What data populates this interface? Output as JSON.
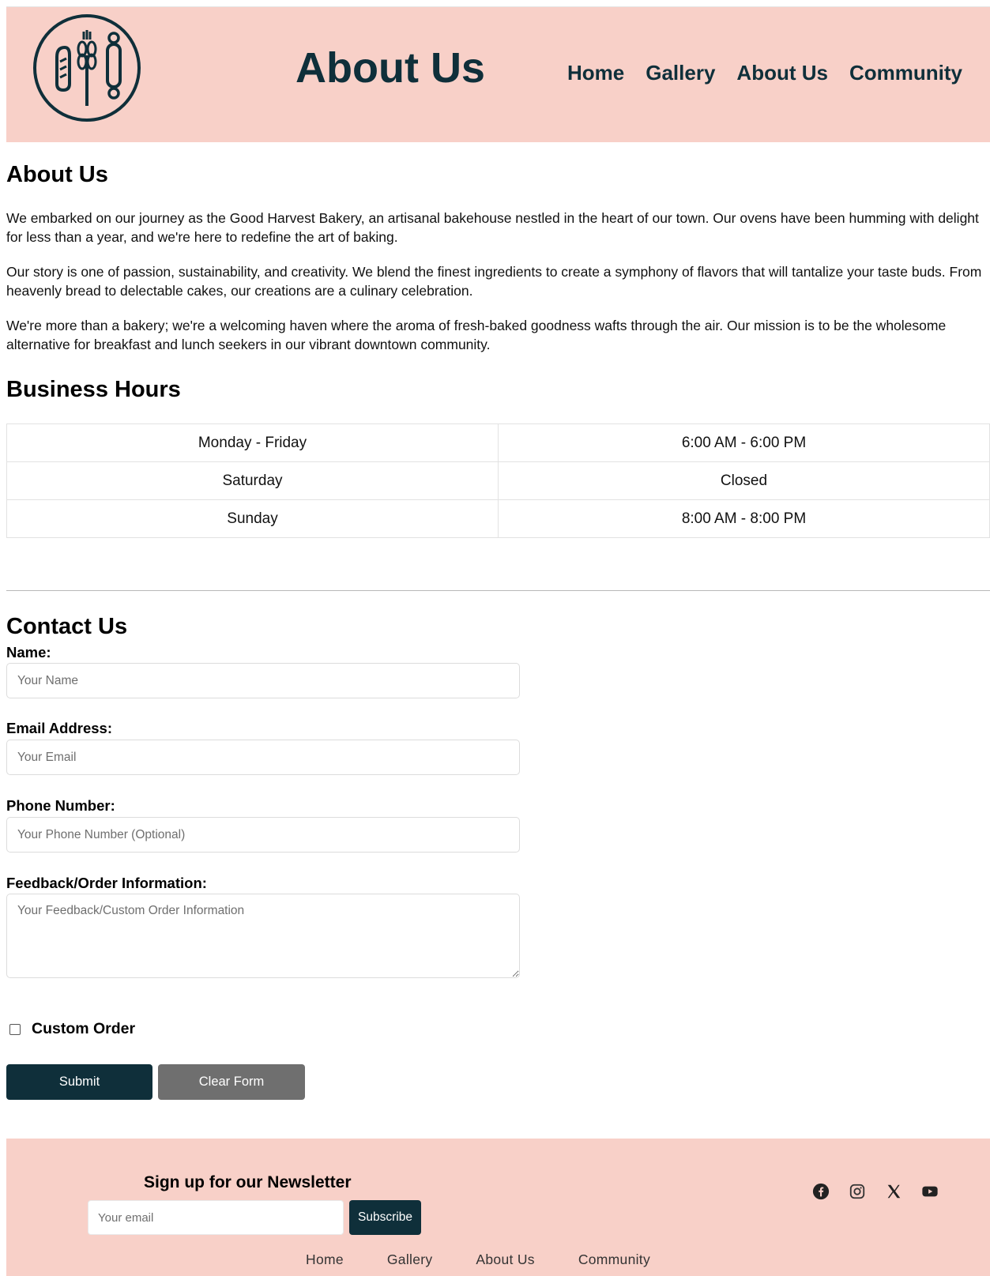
{
  "header": {
    "logo_icon": "bakery-logo-icon",
    "title": "About Us",
    "nav": [
      {
        "label": "Home"
      },
      {
        "label": "Gallery"
      },
      {
        "label": "About Us"
      },
      {
        "label": "Community"
      }
    ]
  },
  "about": {
    "heading": "About Us",
    "paragraphs": [
      "We embarked on our journey as the Good Harvest Bakery, an artisanal bakehouse nestled in the heart of our town. Our ovens have been humming with delight for less than a year, and we're here to redefine the art of baking.",
      "Our story is one of passion, sustainability, and creativity. We blend the finest ingredients to create a symphony of flavors that will tantalize your taste buds. From heavenly bread to delectable cakes, our creations are a culinary celebration.",
      "We're more than a bakery; we're a welcoming haven where the aroma of fresh-baked goodness wafts through the air. Our mission is to be the wholesome alternative for breakfast and lunch seekers in our vibrant downtown community."
    ]
  },
  "hours": {
    "heading": "Business Hours",
    "rows": [
      {
        "day": "Monday - Friday",
        "time": "6:00 AM - 6:00 PM"
      },
      {
        "day": "Saturday",
        "time": "Closed"
      },
      {
        "day": "Sunday",
        "time": "8:00 AM - 8:00 PM"
      }
    ]
  },
  "contact": {
    "heading": "Contact Us",
    "name_label": "Name:",
    "name_placeholder": "Your Name",
    "email_label": "Email Address:",
    "email_placeholder": "Your Email",
    "phone_label": "Phone Number:",
    "phone_placeholder": "Your Phone Number (Optional)",
    "feedback_label": "Feedback/Order Information:",
    "feedback_placeholder": "Your Feedback/Custom Order Information",
    "custom_order_label": "Custom Order",
    "submit_label": "Submit",
    "clear_label": "Clear Form"
  },
  "footer": {
    "newsletter_title": "Sign up for our Newsletter",
    "email_placeholder": "Your email",
    "subscribe_label": "Subscribe",
    "social_icons": [
      "facebook-icon",
      "instagram-icon",
      "x-icon",
      "youtube-icon"
    ],
    "nav": [
      {
        "label": "Home"
      },
      {
        "label": "Gallery"
      },
      {
        "label": "About Us"
      },
      {
        "label": "Community"
      }
    ]
  },
  "colors": {
    "brand_pink": "#f8d0c8",
    "brand_dark": "#0f2f3a",
    "clear_gray": "#6f6f6f"
  }
}
